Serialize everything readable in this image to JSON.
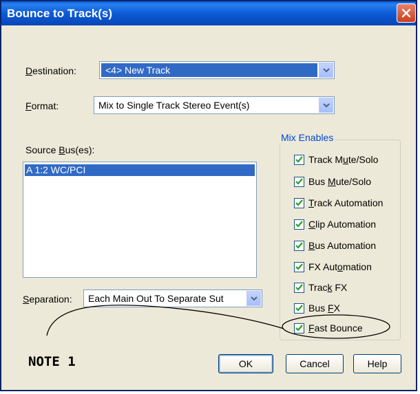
{
  "window": {
    "title": "Bounce to Track(s)"
  },
  "destination": {
    "label": "Destination:",
    "value": "<4> New Track"
  },
  "format": {
    "label": "Format:",
    "value": "Mix to Single Track Stereo Event(s)"
  },
  "source": {
    "label": "Source Bus(es):",
    "items": [
      "A 1:2 WC/PCI"
    ]
  },
  "separation": {
    "label": "Separation:",
    "value": "Each Main Out To Separate Sut"
  },
  "mix_enables": {
    "title": "Mix Enables",
    "items": [
      {
        "label": "Track Mute/Solo",
        "checked": true
      },
      {
        "label": "Bus Mute/Solo",
        "checked": true
      },
      {
        "label": "Track Automation",
        "checked": true
      },
      {
        "label": "Clip Automation",
        "checked": true
      },
      {
        "label": "Bus Automation",
        "checked": true
      },
      {
        "label": "FX Automation",
        "checked": true
      },
      {
        "label": "Track FX",
        "checked": true
      },
      {
        "label": "Bus FX",
        "checked": true
      },
      {
        "label": "Fast Bounce",
        "checked": true
      }
    ]
  },
  "buttons": {
    "ok": "OK",
    "cancel": "Cancel",
    "help": "Help"
  },
  "annotation": {
    "note": "NOTE 1"
  },
  "colors": {
    "title_bar": "#0a5fd8",
    "dialog_bg": "#ece9d8",
    "selection": "#316ac5",
    "check": "#21a121",
    "group_title": "#0046d5"
  }
}
